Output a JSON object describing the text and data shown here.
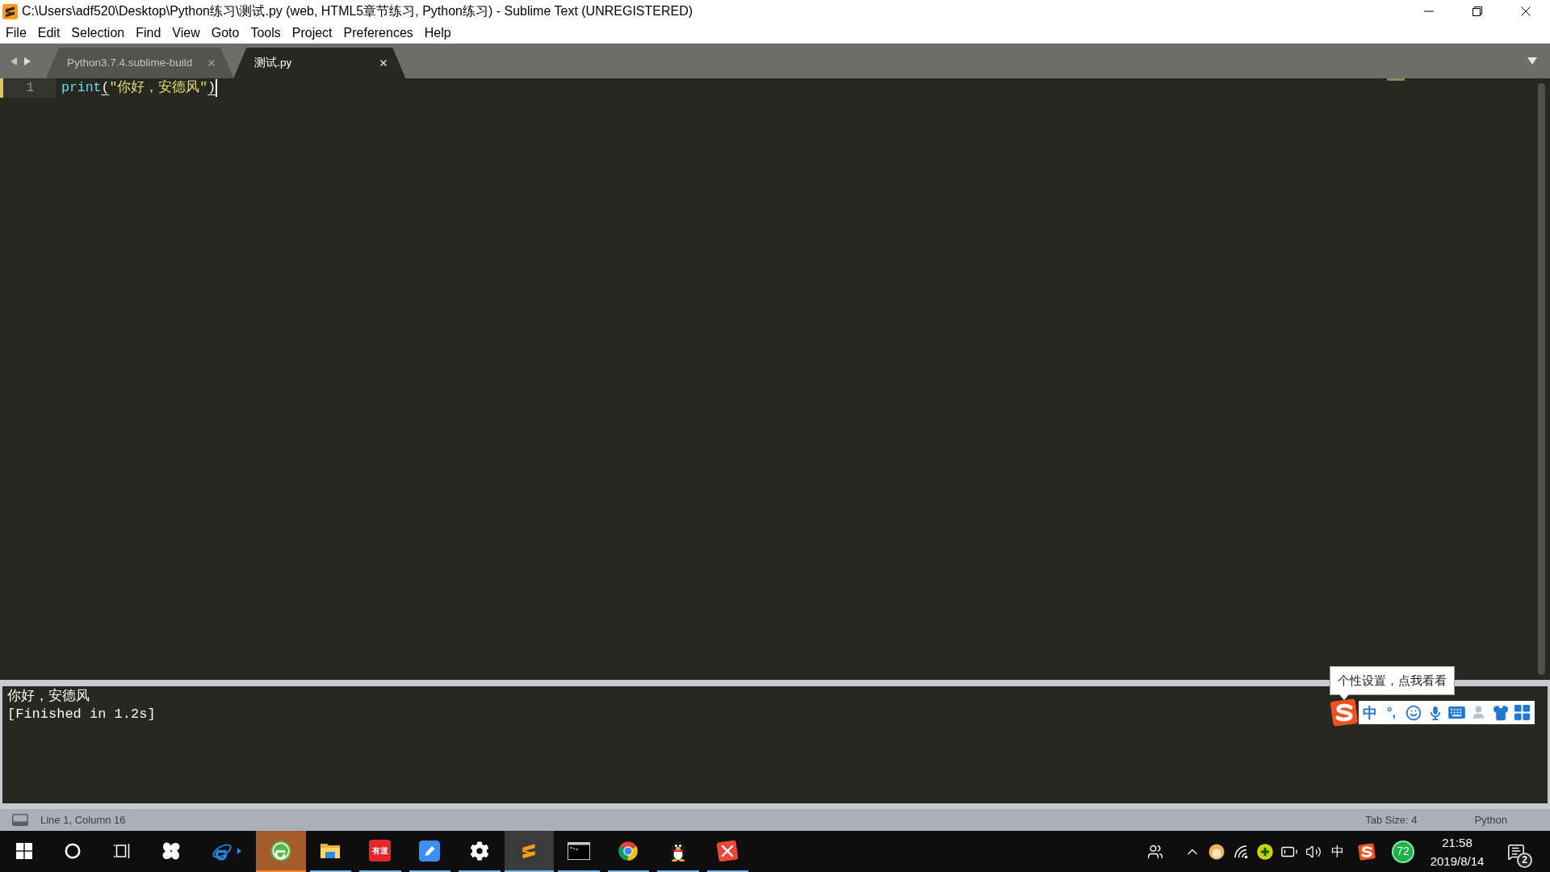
{
  "window": {
    "title": "C:\\Users\\adf520\\Desktop\\Python练习\\测试.py (web, HTML5章节练习, Python练习) - Sublime Text (UNREGISTERED)"
  },
  "menu": [
    "File",
    "Edit",
    "Selection",
    "Find",
    "View",
    "Goto",
    "Tools",
    "Project",
    "Preferences",
    "Help"
  ],
  "tabs": [
    {
      "label": "Python3.7.4.sublime-build",
      "selected": false
    },
    {
      "label": "测试.py",
      "selected": true
    }
  ],
  "editor": {
    "lines": [
      {
        "number": "1",
        "modified": true,
        "has_cursor": true,
        "tokens": [
          {
            "kind": "function",
            "text": "print"
          },
          {
            "kind": "bracket",
            "text": "(",
            "matched": true
          },
          {
            "kind": "string",
            "text": "\"你好，安德风\""
          },
          {
            "kind": "bracket",
            "text": ")",
            "matched": true
          }
        ]
      }
    ]
  },
  "output": {
    "lines": [
      "你好，安德风",
      "[Finished in 1.2s]"
    ]
  },
  "ime": {
    "tooltip": "个性设置，点我看看",
    "mode": "中",
    "punctuation": "°,"
  },
  "status_bar": {
    "position": "Line 1, Column 16",
    "tab_size": "Tab Size: 4",
    "syntax": "Python"
  },
  "taskbar": {
    "buttons": [
      {
        "kind": "start",
        "running": false,
        "focused": false,
        "flashing": false
      },
      {
        "kind": "search",
        "running": false,
        "focused": false,
        "flashing": false
      },
      {
        "kind": "task-view",
        "running": false,
        "focused": false,
        "flashing": false
      },
      {
        "kind": "fan",
        "running": false,
        "focused": false,
        "flashing": false
      },
      {
        "kind": "e-blue",
        "running": false,
        "focused": false,
        "flashing": false
      },
      {
        "kind": "e-green",
        "running": true,
        "focused": false,
        "flashing": true
      },
      {
        "kind": "folder",
        "running": true,
        "focused": false,
        "flashing": false
      },
      {
        "kind": "dict",
        "running": true,
        "focused": false,
        "flashing": false,
        "label": "有道"
      },
      {
        "kind": "pen",
        "running": true,
        "focused": false,
        "flashing": false
      },
      {
        "kind": "gear",
        "running": true,
        "focused": false,
        "flashing": false
      },
      {
        "kind": "sublime",
        "running": true,
        "focused": true,
        "flashing": false
      },
      {
        "kind": "terminal",
        "running": true,
        "focused": false,
        "flashing": false
      },
      {
        "kind": "chrome",
        "running": true,
        "focused": false,
        "flashing": false
      },
      {
        "kind": "penguin",
        "running": true,
        "focused": false,
        "flashing": false
      },
      {
        "kind": "x-tile",
        "running": true,
        "focused": false,
        "flashing": false
      }
    ],
    "tray": {
      "input_mode": "中",
      "status_badge": "72"
    },
    "clock": {
      "time": "21:58",
      "date": "2019/8/14"
    },
    "notifications": "2"
  }
}
